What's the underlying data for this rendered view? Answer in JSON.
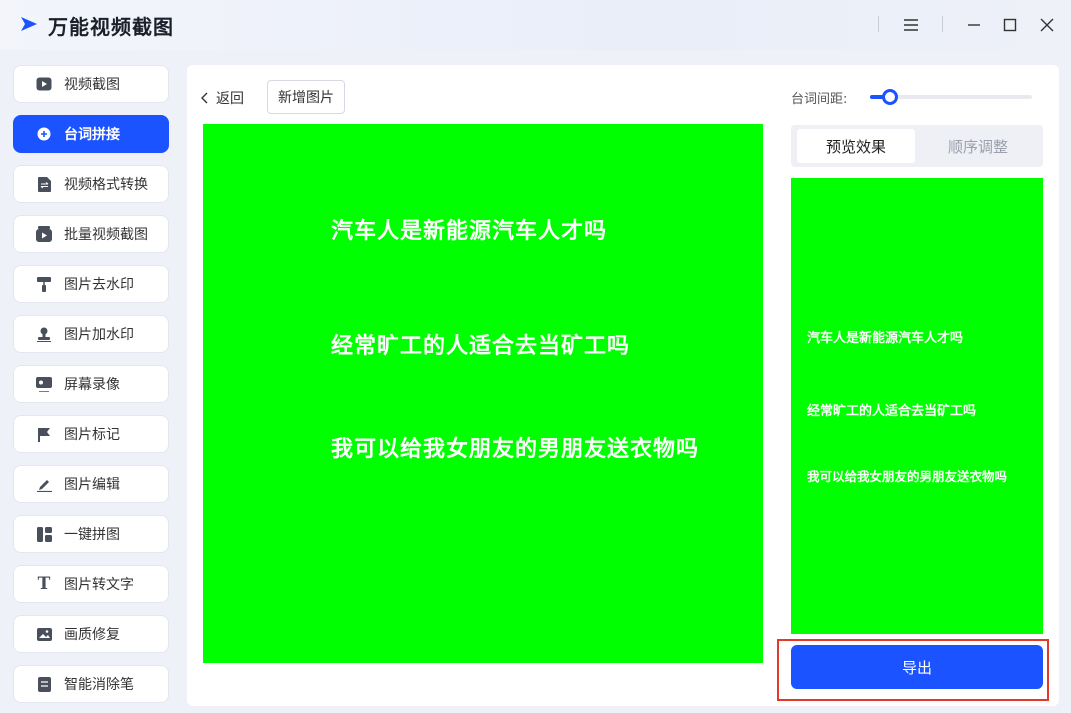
{
  "app": {
    "title": "万能视频截图"
  },
  "sidebar": {
    "items": [
      {
        "label": "视频截图",
        "icon": "video-play-icon"
      },
      {
        "label": "台词拼接",
        "icon": "plus-circle-icon",
        "active": true
      },
      {
        "label": "视频格式转换",
        "icon": "file-convert-icon"
      },
      {
        "label": "批量视频截图",
        "icon": "batch-video-icon"
      },
      {
        "label": "图片去水印",
        "icon": "paint-roller-icon"
      },
      {
        "label": "图片加水印",
        "icon": "stamp-icon"
      },
      {
        "label": "屏幕录像",
        "icon": "screen-record-icon"
      },
      {
        "label": "图片标记",
        "icon": "flag-icon"
      },
      {
        "label": "图片编辑",
        "icon": "pencil-edit-icon"
      },
      {
        "label": "一键拼图",
        "icon": "collage-icon"
      },
      {
        "label": "图片转文字",
        "icon": "text-t-icon"
      },
      {
        "label": "画质修复",
        "icon": "image-repair-icon"
      },
      {
        "label": "智能消除笔",
        "icon": "eraser-doc-icon"
      }
    ]
  },
  "toolbar": {
    "back_label": "返回",
    "add_image_label": "新增图片"
  },
  "spacing": {
    "label": "台词间距:",
    "value": 0.1
  },
  "tabs": {
    "preview": "预览效果",
    "order": "顺序调整"
  },
  "subtitles": [
    "汽车人是新能源汽车人才吗",
    "经常旷工的人适合去当矿工吗",
    "我可以给我女朋友的男朋友送衣物吗"
  ],
  "export_label": "导出",
  "colors": {
    "accent": "#1a53ff",
    "canvas_bg": "#00ff00",
    "highlight": "#e23a2a"
  }
}
